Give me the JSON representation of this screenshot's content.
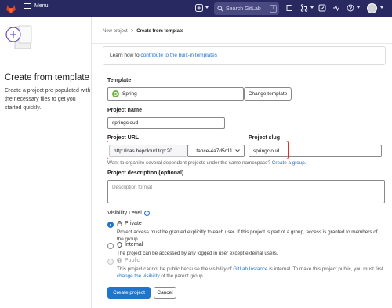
{
  "topbar": {
    "menu_label": "Menu",
    "search_placeholder": "Search GitLab",
    "search_shortcut": "/",
    "colors": {
      "bg": "#292961",
      "logo": "#e24329"
    }
  },
  "sidebar": {
    "title": "Create from template",
    "description": "Create a project pre-populated with the necessary files to get you started quickly."
  },
  "breadcrumb": {
    "items": [
      "New project",
      "Create from template"
    ],
    "separator": ">"
  },
  "info": {
    "prefix": "Learn how to ",
    "link": "contribute to the built-in templates"
  },
  "template": {
    "label": "Template",
    "selected": "Spring",
    "change_button": "Change template"
  },
  "project_name": {
    "label": "Project name",
    "value": "springcloud"
  },
  "project_url": {
    "label": "Project URL",
    "base": "http://nas.hepcloud.top:20...",
    "namespace": "...tance-4a7d5c11"
  },
  "project_slug": {
    "label": "Project slug",
    "value": "springcloud"
  },
  "namespace_help": {
    "text": "Want to organize several dependent projects under the same namespace? ",
    "link": "Create a group."
  },
  "description": {
    "label": "Project description (optional)",
    "placeholder": "Description format"
  },
  "visibility": {
    "label": "Visibility Level",
    "help_icon": "?",
    "options": [
      {
        "title": "Private",
        "selected": true,
        "disabled": false,
        "desc": "Project access must be granted explicitly to each user. If this project is part of a group, access is granted to members of the group."
      },
      {
        "title": "Internal",
        "selected": false,
        "disabled": false,
        "desc": "The project can be accessed by any logged in user except external users."
      },
      {
        "title": "Public",
        "selected": false,
        "disabled": true,
        "desc_a": "This project cannot be public because the visibility of ",
        "desc_link1": "GitLab Instance",
        "desc_b": " is internal. To make this project public, you must first ",
        "desc_link2": "change the visibility",
        "desc_c": " of the parent group."
      }
    ]
  },
  "actions": {
    "create": "Create project",
    "cancel": "Cancel"
  }
}
